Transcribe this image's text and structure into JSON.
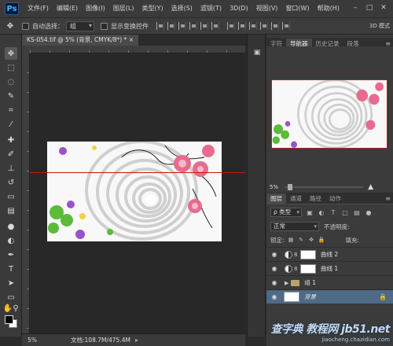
{
  "app": {
    "logo": "Ps",
    "menu": [
      "文件(F)",
      "编辑(E)",
      "图像(I)",
      "图层(L)",
      "类型(Y)",
      "选择(S)",
      "滤镜(T)",
      "3D(D)",
      "视图(V)",
      "窗口(W)",
      "帮助(H)"
    ],
    "window_controls": [
      "–",
      "□",
      "✕"
    ]
  },
  "options_bar": {
    "auto_select_label": "自动选择：",
    "auto_select_value": "组",
    "show_transform_label": "显示变换控件",
    "mode_3d_label": "3D 模式"
  },
  "document": {
    "tab_title": "KS-054.tif @ 5% (背景, CMYK/8*) *",
    "close": "×"
  },
  "statusbar": {
    "zoom": "5%",
    "doc_size": "文档:108.7M/475.4M",
    "arrow": "▸"
  },
  "navigator_panel": {
    "tabs": [
      "字符",
      "导航器",
      "历史记录",
      "段落"
    ],
    "active_tab": "导航器",
    "menu": "≡",
    "zoom_text": "5%",
    "zoom_in": "▲"
  },
  "layers_panel": {
    "tabs": [
      "图层",
      "通道",
      "路径",
      "动作"
    ],
    "active_tab": "图层",
    "menu": "≡",
    "kind_filter": "ρ 类型",
    "blend_mode": "正常",
    "opacity_label": "不透明度:",
    "opacity_value": "",
    "lock_label": "锁定:",
    "fill_label": "填充:",
    "fill_value": "",
    "layers": [
      {
        "name": "曲线 2",
        "type": "adjustment",
        "selected": false
      },
      {
        "name": "曲线 1",
        "type": "adjustment",
        "selected": false
      },
      {
        "name": "组 1",
        "type": "group",
        "selected": false
      },
      {
        "name": "背景",
        "type": "background",
        "selected": true,
        "locked": true
      }
    ],
    "eye_icon": "◉",
    "lock_icon": "🔒"
  },
  "tools": [
    "move-icon",
    "marquee-icon",
    "lasso-icon",
    "quick-select-icon",
    "crop-icon",
    "eyedropper-icon",
    "healing-icon",
    "brush-icon",
    "stamp-icon",
    "history-brush-icon",
    "eraser-icon",
    "gradient-icon",
    "blur-icon",
    "dodge-icon",
    "pen-icon",
    "type-icon",
    "path-select-icon",
    "shape-icon",
    "hand-icon",
    "zoom-icon"
  ],
  "colors": {
    "foreground": "#000000",
    "background": "#ffffff",
    "guide": "#c01a1a",
    "selected_layer": "#4d6a86"
  },
  "watermark": {
    "main": "查字典 教程网",
    "site": "jb51.net",
    "sub": "jiaocheng.chazidian.com"
  }
}
